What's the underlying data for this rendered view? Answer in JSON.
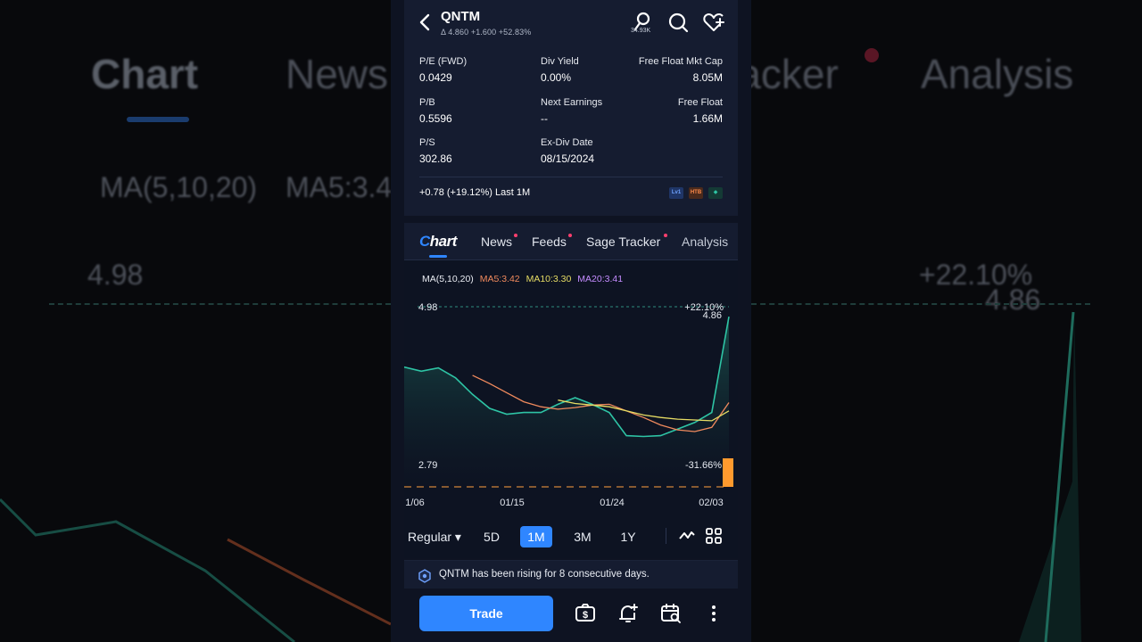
{
  "backdrop": {
    "tab_chart": "Chart",
    "tab_news": "News",
    "tab_tracker": "racker",
    "tab_analysis": "Analysis",
    "ma_label": "MA(5,10,20)",
    "ma5_fragment": "MA5:3.4",
    "price_high": "4.98",
    "pct_high": "+22.10%",
    "price_last": "4.86"
  },
  "header": {
    "ticker": "QNTM",
    "quote_line": "Δ 4.860 +1.600 +52.83%",
    "people_count": "34.93K"
  },
  "stats": [
    {
      "label": "P/E (FWD)",
      "value": "0.0429"
    },
    {
      "label": "Div Yield",
      "value": "0.00%"
    },
    {
      "label": "Free Float Mkt Cap",
      "value": "8.05M"
    },
    {
      "label": "P/B",
      "value": "0.5596"
    },
    {
      "label": "Next Earnings",
      "value": "--"
    },
    {
      "label": "Free Float",
      "value": "1.66M"
    },
    {
      "label": "P/S",
      "value": "302.86"
    },
    {
      "label": "Ex-Div Date",
      "value": "08/15/2024"
    }
  ],
  "performance": "+0.78 (+19.12%) Last 1M",
  "badges": [
    "Lv1",
    "HTB",
    "◆"
  ],
  "tabs": {
    "chart": "hart",
    "chart_c": "C",
    "news": "News",
    "feeds": "Feeds",
    "sage_tracker": "Sage Tracker",
    "analysis": "Analysis"
  },
  "ma": {
    "label": "MA(5,10,20)",
    "ma5": "MA5:3.42",
    "ma10": "MA10:3.30",
    "ma20": "MA20:3.41"
  },
  "chart_labels": {
    "high_price": "4.98",
    "high_pct": "+22.10%",
    "last_price": "4.86",
    "low_price": "2.79",
    "low_pct": "-31.66%"
  },
  "chart_data": {
    "type": "line",
    "x": [
      "01/06",
      "01/07",
      "01/08",
      "01/09",
      "01/10",
      "01/13",
      "01/14",
      "01/15",
      "01/16",
      "01/17",
      "01/21",
      "01/22",
      "01/23",
      "01/24",
      "01/27",
      "01/28",
      "01/29",
      "01/30",
      "01/31",
      "02/03"
    ],
    "x_ticks": [
      "1/06",
      "01/15",
      "01/24",
      "02/03"
    ],
    "ylim": [
      2.79,
      4.98
    ],
    "series": [
      {
        "name": "",
        "color": "#2ec4a5",
        "values": [
          4.25,
          4.2,
          4.24,
          4.12,
          3.92,
          3.75,
          3.68,
          3.7,
          3.7,
          3.8,
          3.88,
          3.8,
          3.7,
          3.42,
          3.41,
          3.42,
          3.5,
          3.58,
          3.7,
          4.86
        ]
      },
      {
        "name": "MA5",
        "color": "#f08a5d",
        "values": [
          null,
          null,
          null,
          null,
          4.15,
          4.05,
          3.94,
          3.83,
          3.77,
          3.74,
          3.76,
          3.79,
          3.8,
          3.72,
          3.64,
          3.55,
          3.49,
          3.47,
          3.52,
          3.82
        ]
      },
      {
        "name": "MA10",
        "color": "#e6dc64",
        "values": [
          null,
          null,
          null,
          null,
          null,
          null,
          null,
          null,
          null,
          3.85,
          3.81,
          3.79,
          3.77,
          3.72,
          3.67,
          3.64,
          3.62,
          3.61,
          3.6,
          3.72
        ]
      }
    ]
  },
  "ranges": {
    "regular": "Regular ▾",
    "d5": "5D",
    "m1": "1M",
    "m3": "3M",
    "y1": "1Y"
  },
  "insight": "QNTM has been rising for 8 consecutive days.",
  "bottom": {
    "trade": "Trade"
  }
}
